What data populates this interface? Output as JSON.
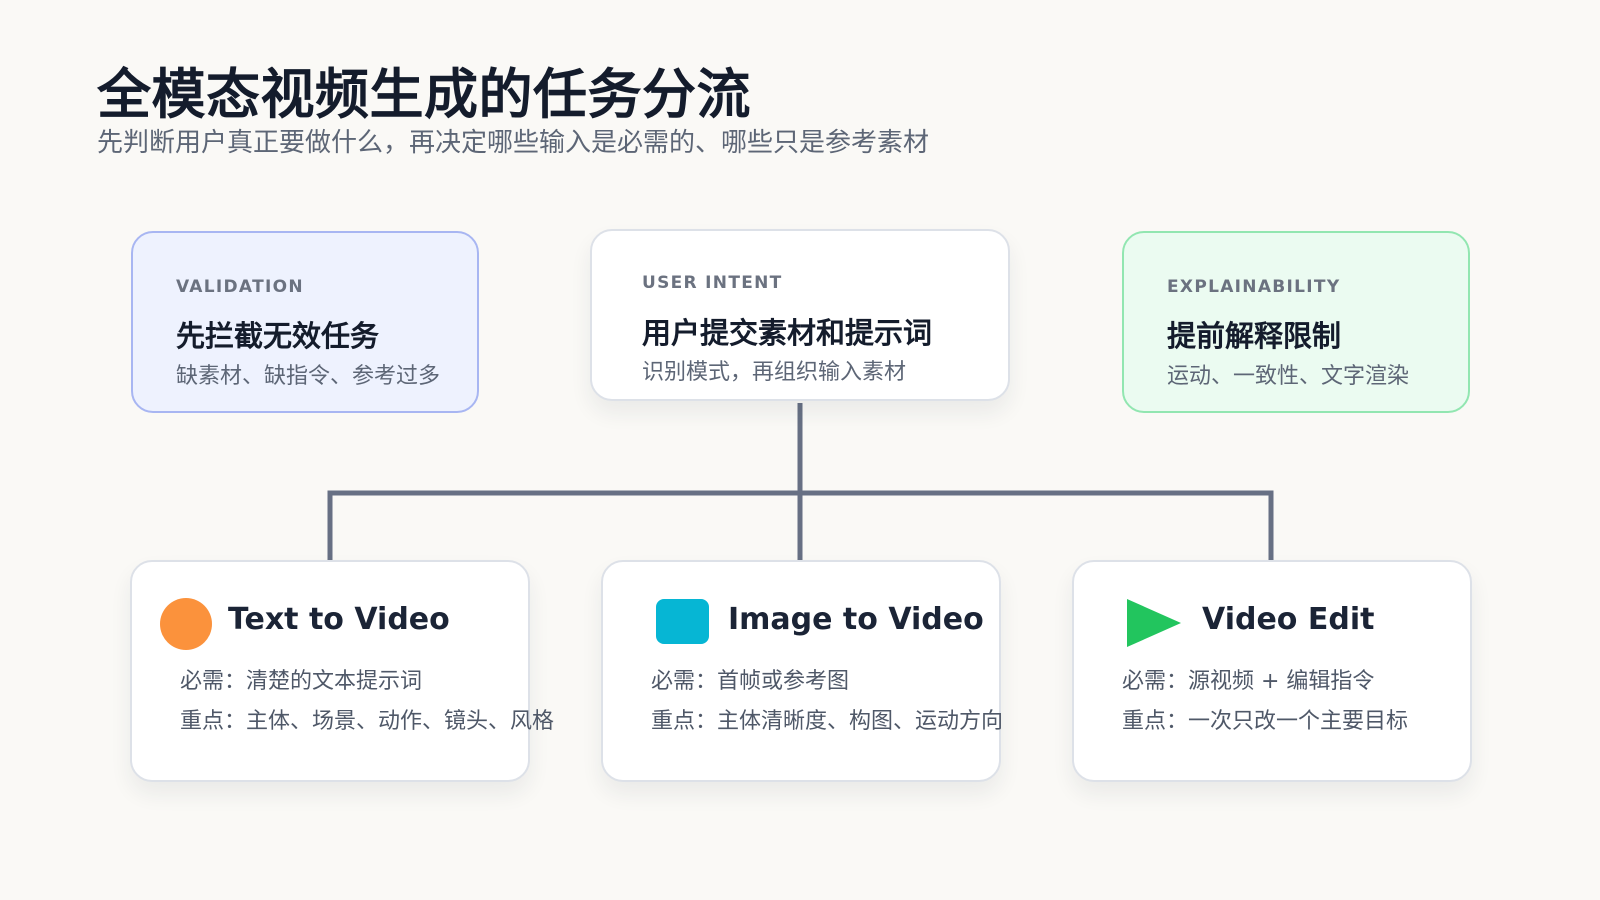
{
  "title": "全模态视频生成的任务分流",
  "subtitle": "先判断用户真正要做什么，再决定哪些输入是必需的、哪些只是参考素材",
  "top_cards": {
    "validation": {
      "eyebrow": "VALIDATION",
      "title": "先拦截无效任务",
      "desc": "缺素材、缺指令、参考过多"
    },
    "intent": {
      "eyebrow": "USER INTENT",
      "title": "用户提交素材和提示词",
      "desc": "识别模式，再组织输入素材"
    },
    "explain": {
      "eyebrow": "EXPLAINABILITY",
      "title": "提前解释限制",
      "desc": "运动、一致性、文字渲染"
    }
  },
  "modes": [
    {
      "title": "Text to Video",
      "required": "必需：清楚的文本提示词",
      "focus": "重点：主体、场景、动作、镜头、风格",
      "icon": "orange-circle-icon"
    },
    {
      "title": "Image to Video",
      "required": "必需：首帧或参考图",
      "focus": "重点：主体清晰度、构图、运动方向",
      "icon": "cyan-square-icon"
    },
    {
      "title": "Video Edit",
      "required": "必需：源视频 + 编辑指令",
      "focus": "重点：一次只改一个主要目标",
      "icon": "green-play-icon"
    }
  ],
  "colors": {
    "connector": "#677084",
    "text_to_video_icon": "#fb923c",
    "image_to_video_icon": "#06b6d4",
    "video_edit_icon": "#22c55e",
    "validation_bg": "#eef2fe",
    "explain_bg": "#ebfbf1"
  }
}
